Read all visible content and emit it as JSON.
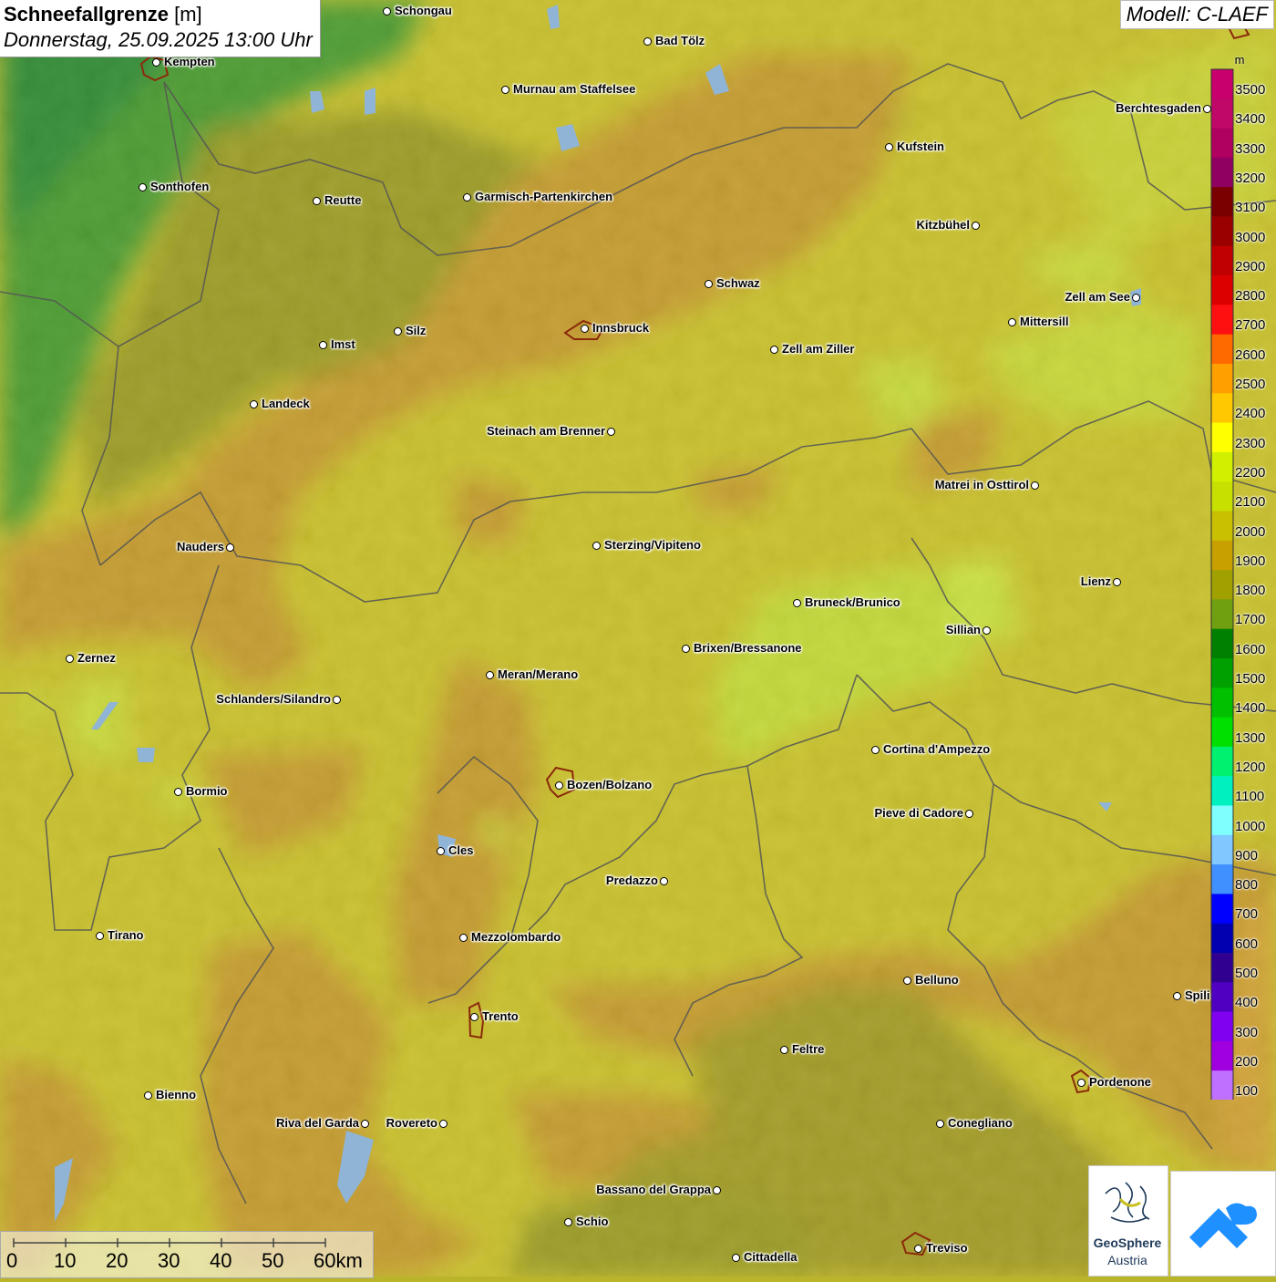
{
  "title": {
    "main": "Schneefallgrenze",
    "unit": "[m]",
    "datetime": "Donnerstag, 25.09.2025 13:00 Uhr"
  },
  "model": "Modell: C-LAEF",
  "legend": {
    "unit": "m",
    "labels": [
      "3500",
      "3400",
      "3300",
      "3200",
      "3100",
      "3000",
      "2900",
      "2800",
      "2700",
      "2600",
      "2500",
      "2400",
      "2300",
      "2200",
      "2100",
      "2000",
      "1900",
      "1800",
      "1700",
      "1600",
      "1500",
      "1400",
      "1300",
      "1200",
      "1100",
      "1000",
      "900",
      "800",
      "700",
      "600",
      "500",
      "400",
      "300",
      "200",
      "100"
    ],
    "colors": [
      "#c8006e",
      "#c00868",
      "#b00060",
      "#900060",
      "#7a0000",
      "#9a0000",
      "#c00000",
      "#dd0000",
      "#ff1010",
      "#ff6a00",
      "#ffa000",
      "#ffc800",
      "#ffff00",
      "#d0f000",
      "#c8e000",
      "#c8c000",
      "#c8a000",
      "#a0a000",
      "#70a010",
      "#008000",
      "#00a000",
      "#00c000",
      "#00e000",
      "#00f070",
      "#00f0c0",
      "#80ffff",
      "#80c8ff",
      "#4090ff",
      "#0000ff",
      "#0000b0",
      "#300090",
      "#5000c0",
      "#8000f0",
      "#a000e0",
      "#c070ff"
    ]
  },
  "cities": [
    {
      "name": "Schongau",
      "label_side": "right"
    },
    {
      "name": "Bad Tölz",
      "label_side": "right"
    },
    {
      "name": "Kempten",
      "label_side": "right"
    },
    {
      "name": "Murnau am Staffelsee",
      "label_side": "right"
    },
    {
      "name": "Berchtesgaden",
      "label_side": "left"
    },
    {
      "name": "Kufstein",
      "label_side": "right"
    },
    {
      "name": "Sonthofen",
      "label_side": "right"
    },
    {
      "name": "Reutte",
      "label_side": "right"
    },
    {
      "name": "Garmisch-Partenkirchen",
      "label_side": "right"
    },
    {
      "name": "Kitzbühel",
      "label_side": "left"
    },
    {
      "name": "Schwaz",
      "label_side": "right"
    },
    {
      "name": "Zell am See",
      "label_side": "left"
    },
    {
      "name": "Innsbruck",
      "label_side": "right"
    },
    {
      "name": "Mittersill",
      "label_side": "right"
    },
    {
      "name": "Silz",
      "label_side": "right"
    },
    {
      "name": "Imst",
      "label_side": "right"
    },
    {
      "name": "Zell am Ziller",
      "label_side": "right"
    },
    {
      "name": "Landeck",
      "label_side": "right"
    },
    {
      "name": "Steinach am Brenner",
      "label_side": "left"
    },
    {
      "name": "Matrei in Osttirol",
      "label_side": "left"
    },
    {
      "name": "Nauders",
      "label_side": "left"
    },
    {
      "name": "Sterzing/Vipiteno",
      "label_side": "right"
    },
    {
      "name": "Lienz",
      "label_side": "left"
    },
    {
      "name": "Bruneck/Brunico",
      "label_side": "right"
    },
    {
      "name": "Sillian",
      "label_side": "left"
    },
    {
      "name": "Brixen/Bressanone",
      "label_side": "right"
    },
    {
      "name": "Zernez",
      "label_side": "right"
    },
    {
      "name": "Meran/Merano",
      "label_side": "right"
    },
    {
      "name": "Schlanders/Silandro",
      "label_side": "left"
    },
    {
      "name": "Cortina d'Ampezzo",
      "label_side": "right"
    },
    {
      "name": "Bozen/Bolzano",
      "label_side": "right"
    },
    {
      "name": "Bormio",
      "label_side": "right"
    },
    {
      "name": "Pieve di Cadore",
      "label_side": "left"
    },
    {
      "name": "Cles",
      "label_side": "right"
    },
    {
      "name": "Predazzo",
      "label_side": "left"
    },
    {
      "name": "Tirano",
      "label_side": "right"
    },
    {
      "name": "Mezzolombardo",
      "label_side": "right"
    },
    {
      "name": "Belluno",
      "label_side": "right"
    },
    {
      "name": "Spili",
      "label_side": "right"
    },
    {
      "name": "Trento",
      "label_side": "right"
    },
    {
      "name": "Feltre",
      "label_side": "right"
    },
    {
      "name": "Pordenone",
      "label_side": "right"
    },
    {
      "name": "Bienno",
      "label_side": "right"
    },
    {
      "name": "Riva del Garda",
      "label_side": "left"
    },
    {
      "name": "Rovereto",
      "label_side": "left"
    },
    {
      "name": "Conegliano",
      "label_side": "right"
    },
    {
      "name": "Bassano del Grappa",
      "label_side": "left"
    },
    {
      "name": "Schio",
      "label_side": "right"
    },
    {
      "name": "Treviso",
      "label_side": "right"
    },
    {
      "name": "Cittadella",
      "label_side": "right"
    }
  ],
  "scale": {
    "ticks": [
      "0",
      "10",
      "20",
      "30",
      "40",
      "50",
      "60km"
    ]
  },
  "logos": {
    "geosphere_line1": "GeoSphere",
    "geosphere_line2": "Austria"
  }
}
